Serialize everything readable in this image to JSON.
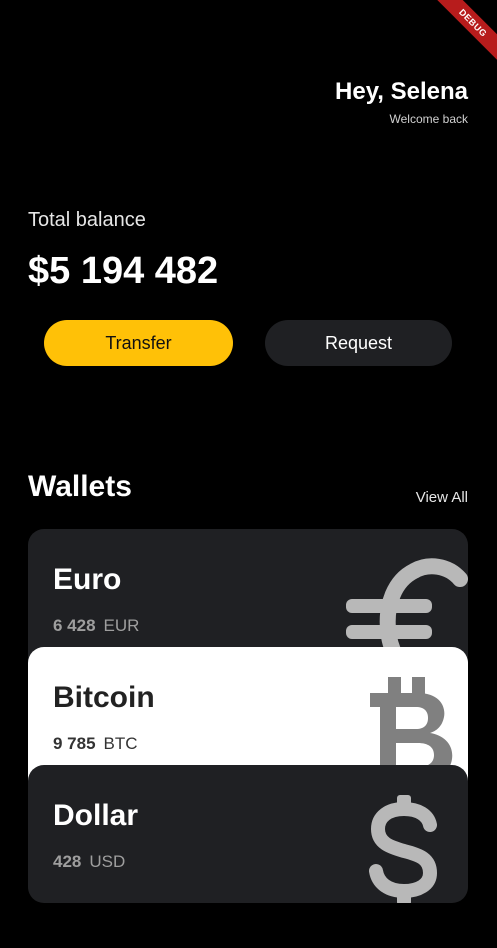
{
  "debug_banner": "DEBUG",
  "header": {
    "greeting": "Hey, Selena",
    "subtitle": "Welcome back"
  },
  "balance": {
    "label": "Total balance",
    "amount": "$5 194 482"
  },
  "actions": {
    "transfer": "Transfer",
    "request": "Request"
  },
  "wallets": {
    "title": "Wallets",
    "view_all": "View All",
    "items": [
      {
        "name": "Euro",
        "amount": "6 428",
        "currency": "EUR",
        "icon": "euro-icon"
      },
      {
        "name": "Bitcoin",
        "amount": "9 785",
        "currency": "BTC",
        "icon": "bitcoin-icon"
      },
      {
        "name": "Dollar",
        "amount": "428",
        "currency": "USD",
        "icon": "dollar-icon"
      }
    ]
  },
  "colors": {
    "background": "#000000",
    "accent": "#ffc107",
    "card_dark": "#1f2023",
    "card_light": "#ffffff",
    "icon_gray": "#b8b8b8"
  }
}
